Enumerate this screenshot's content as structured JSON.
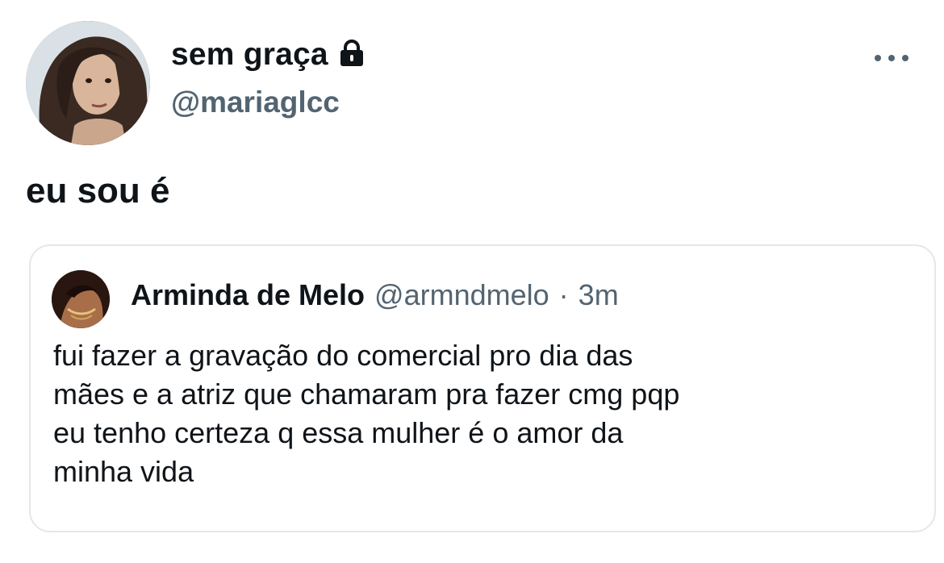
{
  "author": {
    "display_name": "sem graça",
    "handle": "@mariaglcc",
    "protected_icon": "lock-icon",
    "avatar": "profile-photo"
  },
  "menu_icon": "more-horizontal-icon",
  "tweet": {
    "text": "eu sou é"
  },
  "quoted_tweet": {
    "display_name": "Arminda de Melo",
    "handle": "@armndmelo",
    "separator": "·",
    "time": "3m",
    "lines": [
      "fui fazer a gravação do comercial pro dia das",
      "mães e a atriz que chamaram pra fazer cmg pqp",
      "eu tenho certeza q essa mulher é o amor da",
      "minha vida"
    ]
  },
  "colors": {
    "text_primary": "#0f1419",
    "text_secondary": "#536471",
    "border": "#e2e8ec",
    "background": "#ffffff"
  }
}
